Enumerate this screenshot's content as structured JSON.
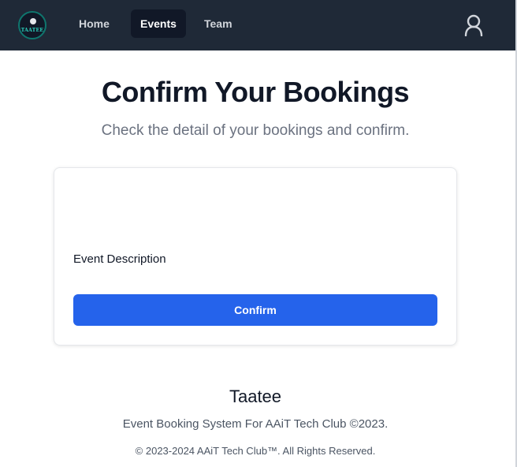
{
  "navbar": {
    "logo_text": "TAATEE",
    "links": [
      {
        "label": "Home",
        "active": false
      },
      {
        "label": "Events",
        "active": true
      },
      {
        "label": "Team",
        "active": false
      }
    ],
    "user_icon": "user-icon"
  },
  "main": {
    "title": "Confirm Your Bookings",
    "subtitle": "Check the detail of your bookings and confirm.",
    "card": {
      "description": "Event Description",
      "confirm_label": "Confirm"
    }
  },
  "footer": {
    "brand": "Taatee",
    "tagline": "Event Booking System For AAiT Tech Club ©2023.",
    "copyright": "© 2023-2024 AAiT Tech Club™. All Rights Reserved."
  },
  "colors": {
    "navbar_bg": "#1f2937",
    "active_link_bg": "#111827",
    "primary_button": "#2563eb"
  }
}
